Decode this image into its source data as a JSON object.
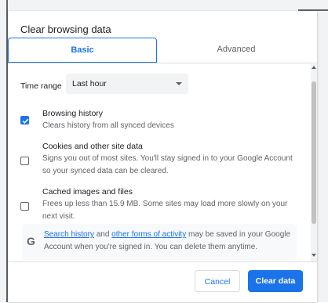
{
  "dialog": {
    "title": "Clear browsing data",
    "tabs": [
      {
        "label": "Basic",
        "selected": true
      },
      {
        "label": "Advanced",
        "selected": false
      }
    ],
    "time_range": {
      "label": "Time range",
      "value": "Last hour"
    },
    "options": [
      {
        "title": "Browsing history",
        "description": "Clears history from all synced devices",
        "checked": true
      },
      {
        "title": "Cookies and other site data",
        "description": "Signs you out of most sites. You'll stay signed in to your Google Account so your synced data can be cleared.",
        "checked": false
      },
      {
        "title": "Cached images and files",
        "description": "Frees up less than 15.9 MB. Some sites may load more slowly on your next visit.",
        "checked": false
      }
    ],
    "google_notice": {
      "icon": "G",
      "link1": "Search history",
      "and": " and ",
      "link2": "other forms of activity",
      "rest": " may be saved in your Google Account when you're signed in. You can delete them anytime."
    },
    "buttons": {
      "cancel": "Cancel",
      "clear": "Clear data"
    }
  },
  "colors": {
    "accent": "#1a73e8",
    "text": "#202124",
    "secondary": "#5f6368"
  }
}
